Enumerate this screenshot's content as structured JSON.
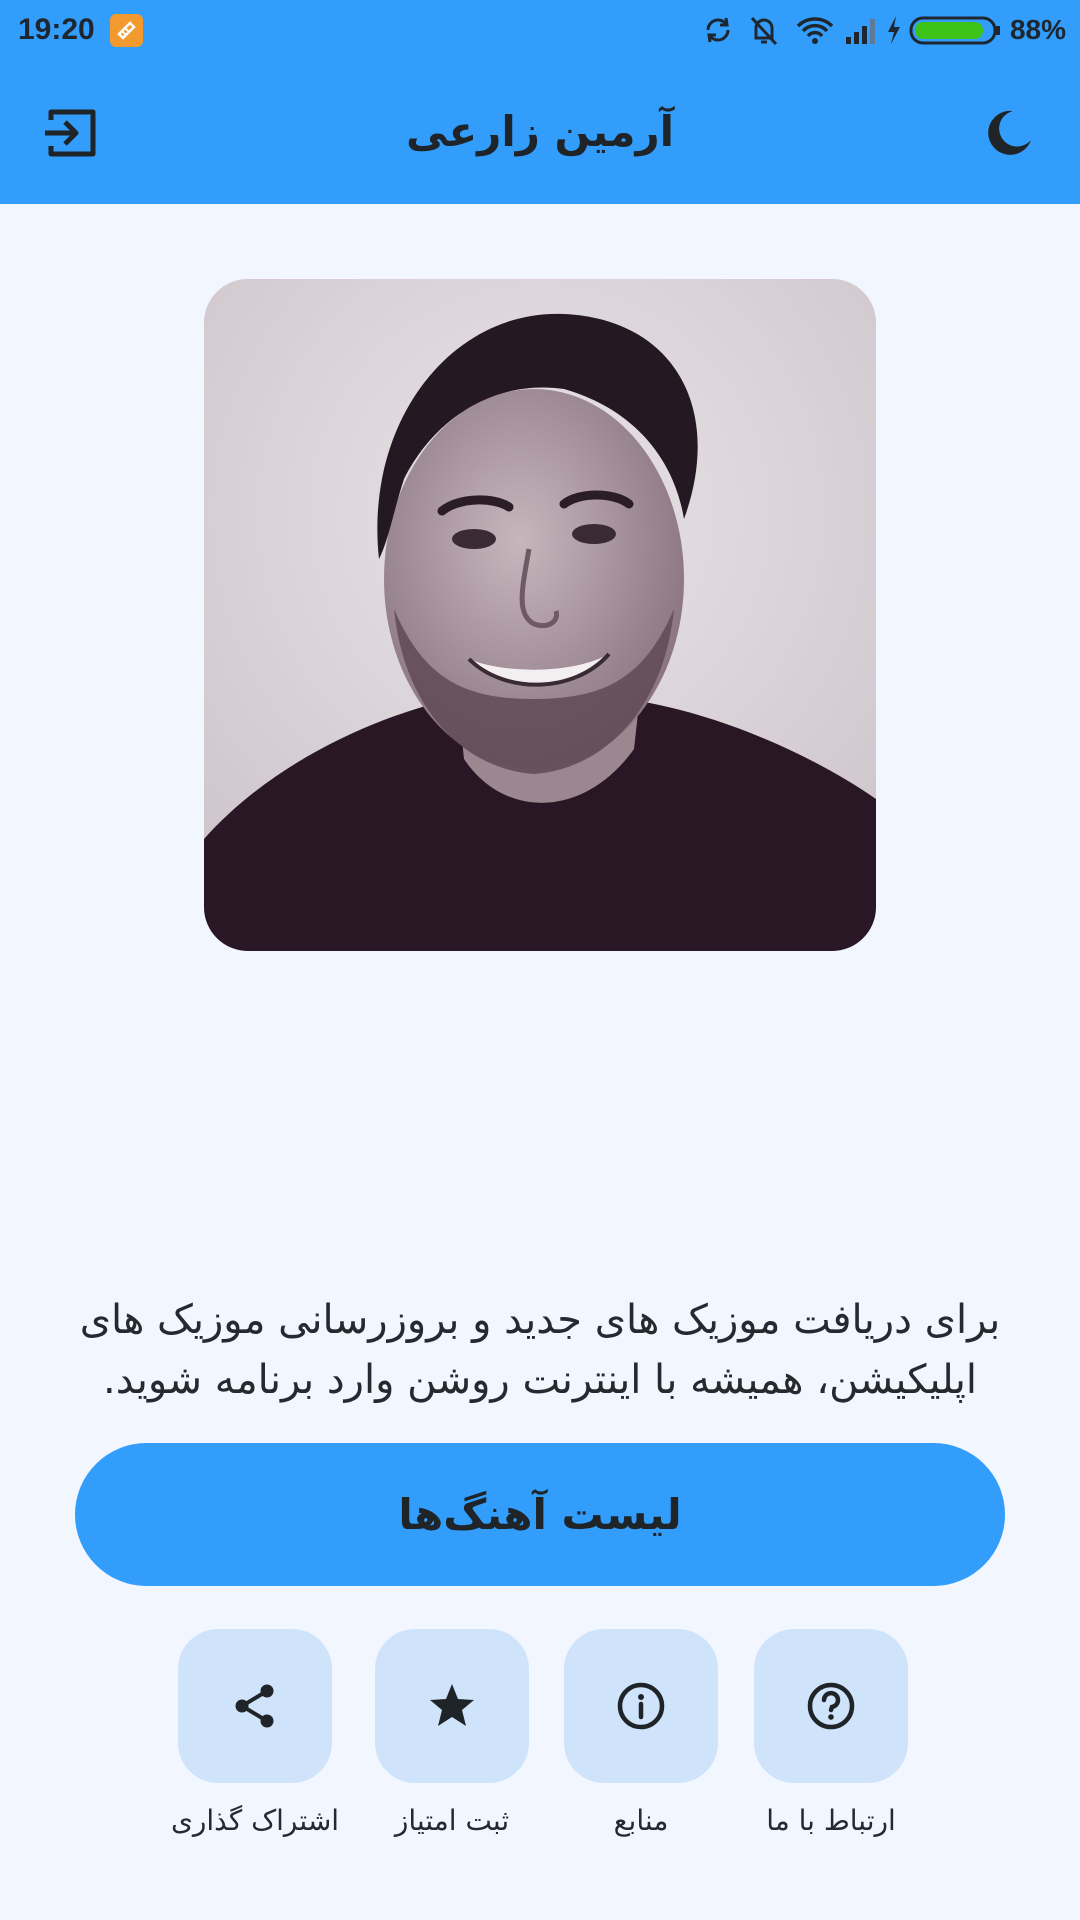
{
  "status_bar": {
    "time": "19:20",
    "battery_percent": "88%",
    "battery_level": 0.88,
    "icons": [
      "app-notification-icon",
      "sync-icon",
      "muted-bell-icon",
      "wifi-icon",
      "signal-icon",
      "charging-icon",
      "battery-icon"
    ]
  },
  "app_bar": {
    "title": "آرمین زارعی",
    "left_icon": "logout-icon",
    "right_icon": "dark-mode-moon-icon"
  },
  "description": "برای دریافت موزیک های جدید و بروزرسانی موزیک های اپلیکیشن، همیشه با اینترنت روشن وارد برنامه شوید.",
  "main_button": {
    "label": "لیست آهنگ‌ها"
  },
  "actions": [
    {
      "label": "ارتباط با ما",
      "icon": "contact-question-icon"
    },
    {
      "label": "منابع",
      "icon": "info-icon"
    },
    {
      "label": "ثبت امتیاز",
      "icon": "star-icon"
    },
    {
      "label": "اشتراک گذاری",
      "icon": "share-icon"
    }
  ],
  "colors": {
    "primary": "#339DFB",
    "background": "#F1F6FF",
    "tile": "#CFE4FB",
    "text": "#1F2428"
  }
}
